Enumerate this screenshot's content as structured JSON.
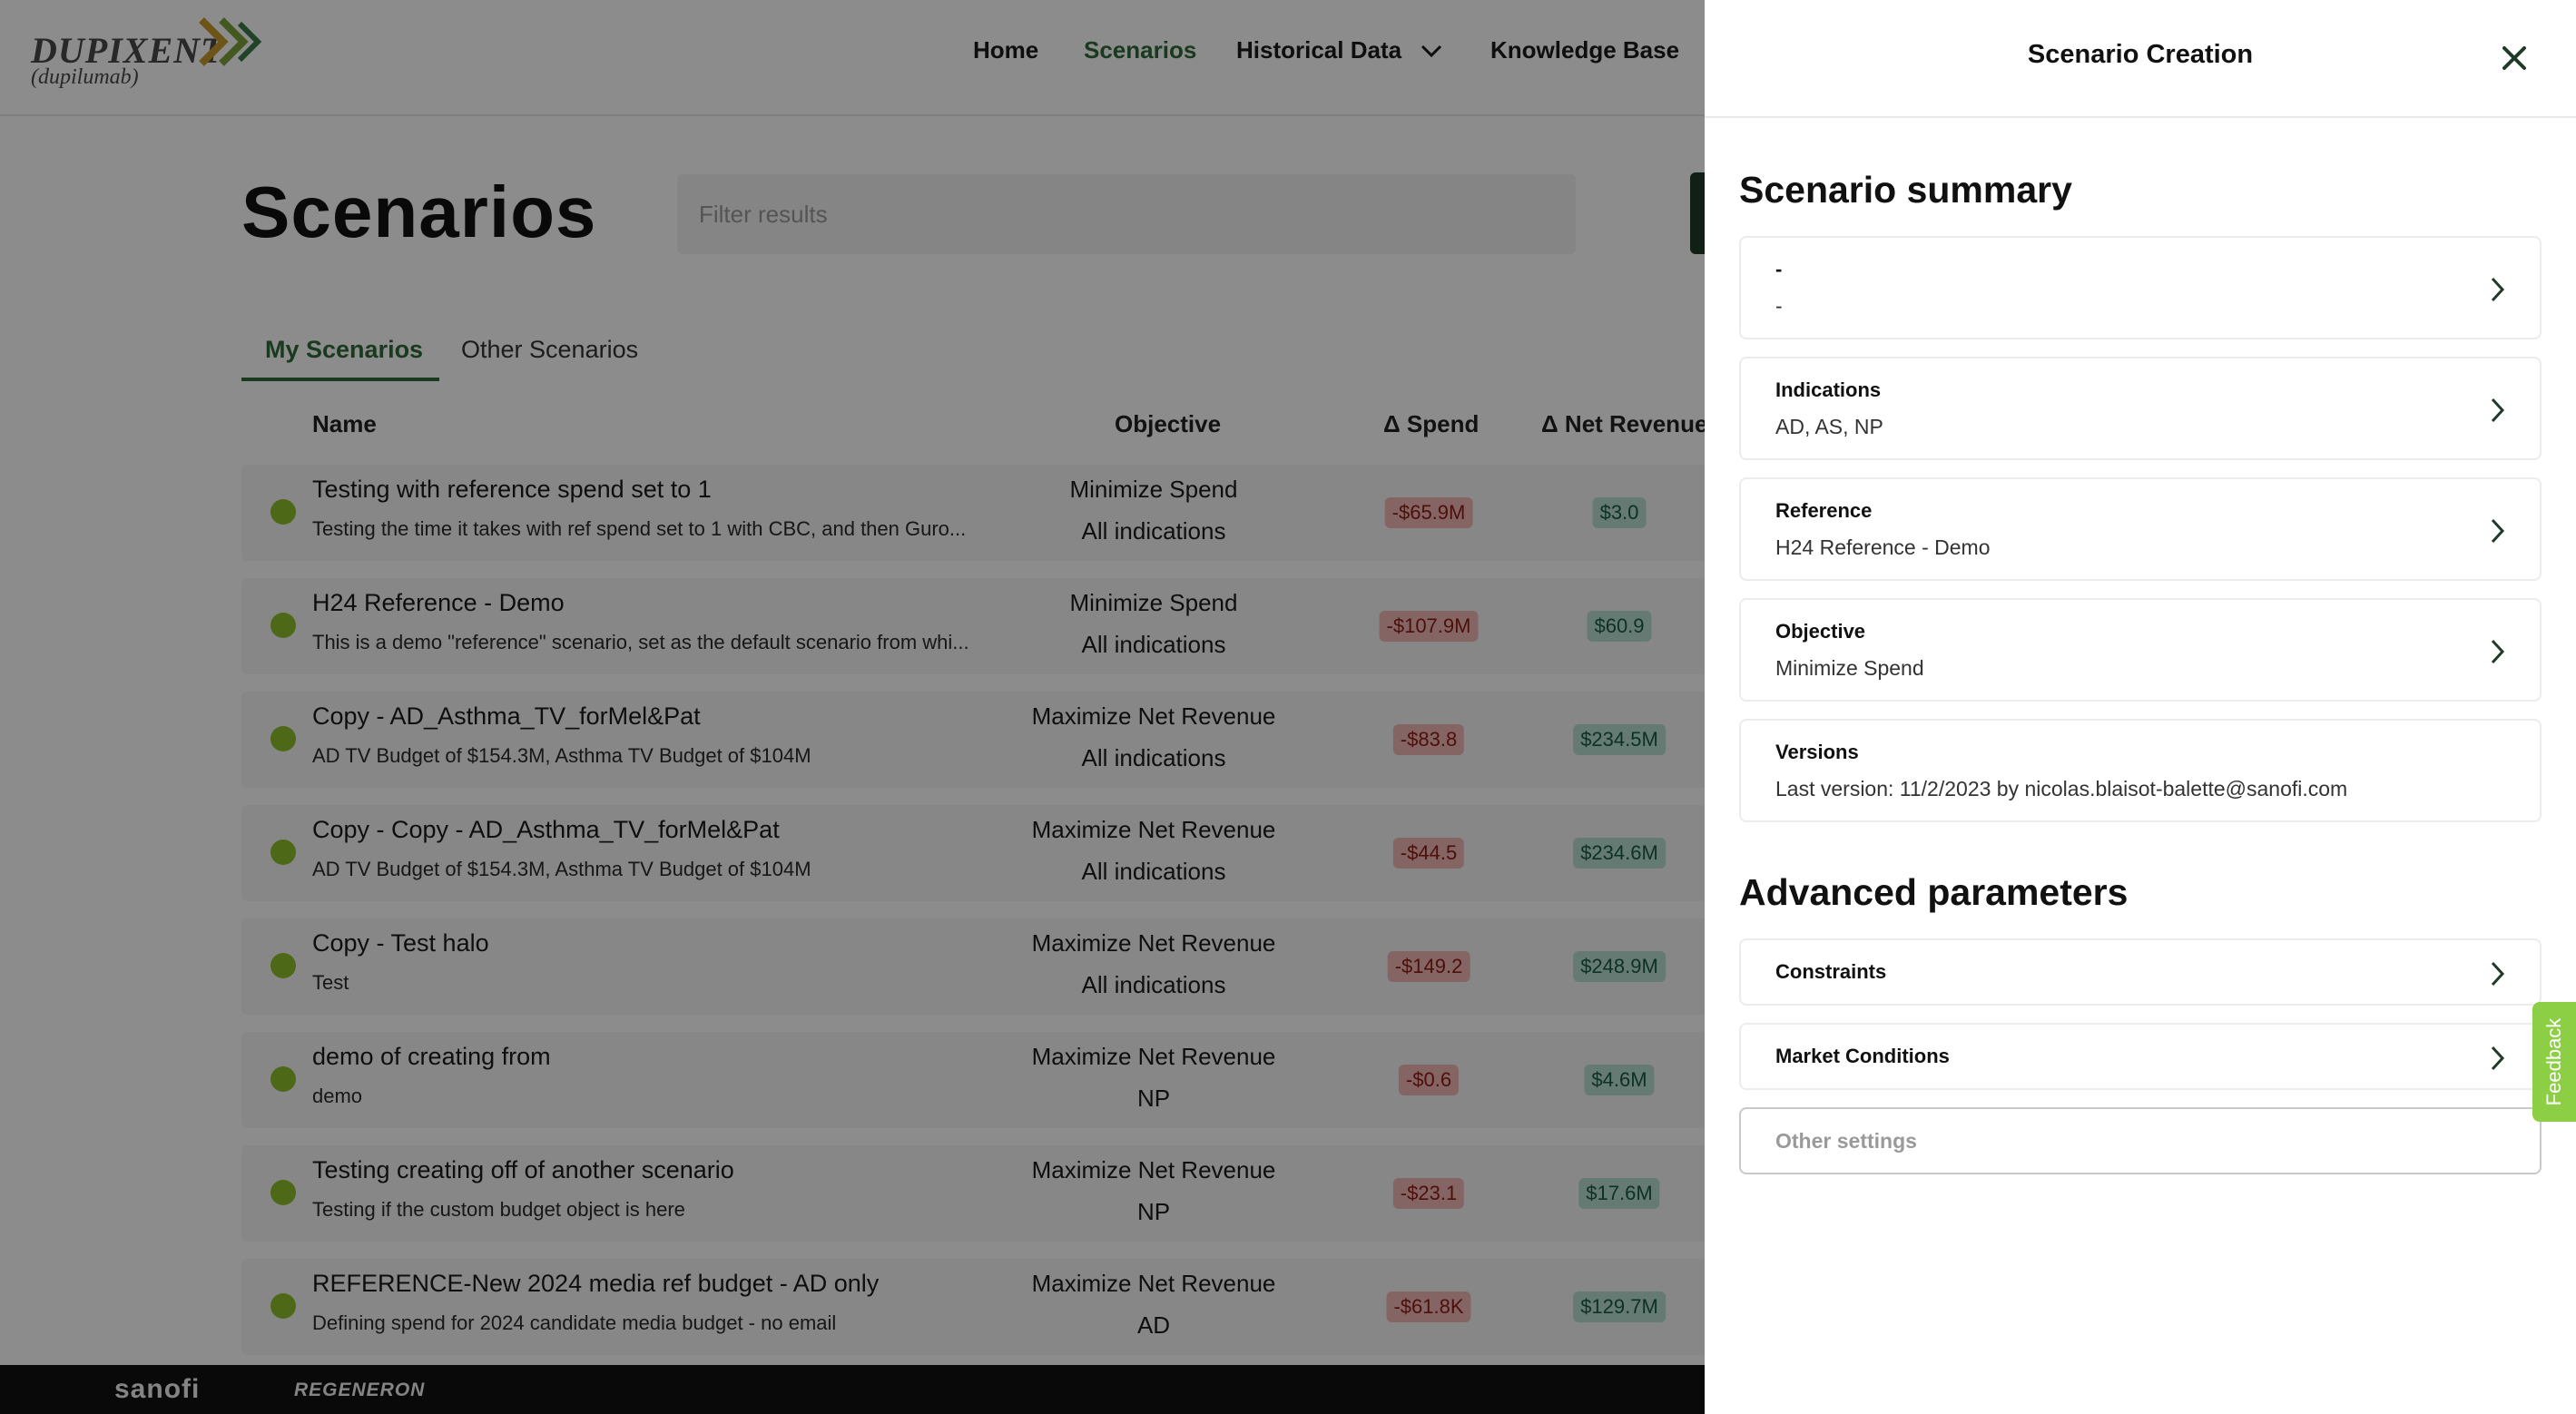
{
  "brand": {
    "name": "DUPIXENT",
    "subname": "(dupilumab)"
  },
  "nav": {
    "home": "Home",
    "scenarios": "Scenarios",
    "historical": "Historical Data",
    "knowledge": "Knowledge Base"
  },
  "page": {
    "title": "Scenarios",
    "filter_placeholder": "Filter results"
  },
  "tabs": {
    "mine": "My Scenarios",
    "other": "Other Scenarios"
  },
  "columns": {
    "name": "Name",
    "objective": "Objective",
    "spend": "Δ Spend",
    "revenue": "Δ Net Revenue"
  },
  "rows": [
    {
      "name": "Testing with reference spend set to 1",
      "desc": "Testing the time it takes with ref spend set to 1 with CBC, and then Guro...",
      "objective": "Minimize Spend",
      "indications": "All indications",
      "spend": "-$65.9M",
      "revenue": "$3.0"
    },
    {
      "name": "H24 Reference - Demo",
      "desc": "This is a demo \"reference\" scenario, set as the default scenario from whi...",
      "objective": "Minimize Spend",
      "indications": "All indications",
      "spend": "-$107.9M",
      "revenue": "$60.9"
    },
    {
      "name": "Copy - AD_Asthma_TV_forMel&Pat",
      "desc": "AD TV Budget of $154.3M, Asthma TV Budget of $104M",
      "objective": "Maximize Net Revenue",
      "indications": "All indications",
      "spend": "-$83.8",
      "revenue": "$234.5M"
    },
    {
      "name": "Copy - Copy - AD_Asthma_TV_forMel&Pat",
      "desc": "AD TV Budget of $154.3M, Asthma TV Budget of $104M",
      "objective": "Maximize Net Revenue",
      "indications": "All indications",
      "spend": "-$44.5",
      "revenue": "$234.6M"
    },
    {
      "name": "Copy - Test halo",
      "desc": "Test",
      "objective": "Maximize Net Revenue",
      "indications": "All indications",
      "spend": "-$149.2",
      "revenue": "$248.9M"
    },
    {
      "name": "demo of creating from",
      "desc": "demo",
      "objective": "Maximize Net Revenue",
      "indications": "NP",
      "spend": "-$0.6",
      "revenue": "$4.6M"
    },
    {
      "name": "Testing creating off of another scenario",
      "desc": "Testing if the custom budget object is here",
      "objective": "Maximize Net Revenue",
      "indications": "NP",
      "spend": "-$23.1",
      "revenue": "$17.6M"
    },
    {
      "name": "REFERENCE-New 2024 media ref budget - AD only",
      "desc": "Defining spend for 2024 candidate media budget - no email",
      "objective": "Maximize Net Revenue",
      "indications": "AD",
      "spend": "-$61.8K",
      "revenue": "$129.7M"
    }
  ],
  "footer": {
    "sanofi": "sanofi",
    "regeneron": "REGENERON"
  },
  "panel": {
    "title": "Scenario Creation",
    "summary_title": "Scenario summary",
    "name_card": {
      "title": "-",
      "value": "-"
    },
    "indications": {
      "title": "Indications",
      "value": "AD, AS, NP"
    },
    "reference": {
      "title": "Reference",
      "value": "H24 Reference - Demo"
    },
    "objective": {
      "title": "Objective",
      "value": "Minimize Spend"
    },
    "versions": {
      "title": "Versions",
      "value": "Last version: 11/2/2023 by nicolas.blaisot-balette@sanofi.com"
    },
    "advanced_title": "Advanced parameters",
    "constraints": "Constraints",
    "market": "Market Conditions",
    "other_settings": "Other settings"
  },
  "feedback": "Feedback",
  "colors": {
    "accent_green": "#2f6b3a",
    "status_dot": "#8dbd2a",
    "feedback": "#8ccf45"
  }
}
